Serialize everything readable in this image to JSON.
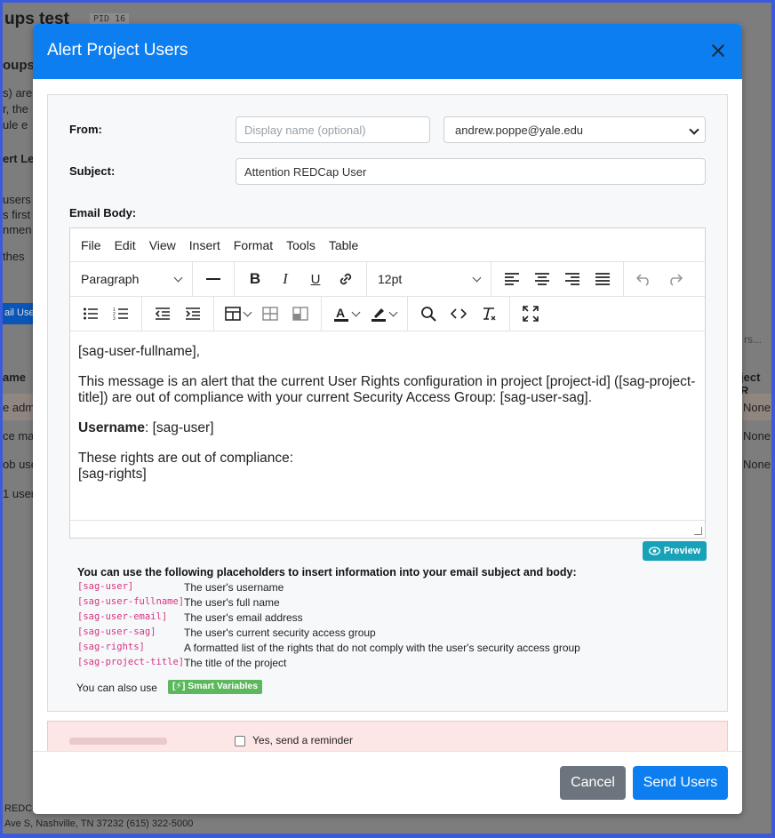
{
  "background": {
    "title": "ups test",
    "pid": "PID 16",
    "fragments": [
      "oups",
      "s) are",
      "r, the",
      "ule e",
      "ert Le",
      "users",
      "s first",
      "nmen",
      "thes",
      "ame",
      "e adm",
      "ce ma",
      "ob use",
      "1 user",
      "rs...",
      "ject R",
      "None",
      "None",
      "None",
      "ail Use"
    ],
    "footer": "Ave S, Nashville, TN 37232 (615) 322-5000",
    "footer_top": "REDC"
  },
  "modal": {
    "title": "Alert Project Users",
    "from_label": "From:",
    "display_name_placeholder": "Display name (optional)",
    "from_email": "andrew.poppe@yale.edu",
    "subject_label": "Subject:",
    "subject_value": "Attention REDCap User",
    "body_label": "Email Body:"
  },
  "editor": {
    "menus": [
      "File",
      "Edit",
      "View",
      "Insert",
      "Format",
      "Tools",
      "Table"
    ],
    "block_format": "Paragraph",
    "font_size": "12pt",
    "content": {
      "line1": "[sag-user-fullname],",
      "line2": "This message is an alert that the current User Rights configuration in project [project-id] ([sag-project-title]) are out of compliance with your current Security Access Group: [sag-user-sag].",
      "username_bold": "Username",
      "username_rest": ": [sag-user]",
      "line4a": "These rights are out of compliance:",
      "line4b": "[sag-rights]"
    }
  },
  "preview_label": "Preview",
  "placeholders": {
    "title": "You can use the following placeholders to insert information into your email subject and body:",
    "items": [
      {
        "code": "[sag-user]",
        "desc": "The user's username"
      },
      {
        "code": "[sag-user-fullname]",
        "desc": "The user's full name"
      },
      {
        "code": "[sag-user-email]",
        "desc": "The user's email address"
      },
      {
        "code": "[sag-user-sag]",
        "desc": "The user's current security access group"
      },
      {
        "code": "[sag-rights]",
        "desc": "A formatted list of the rights that do not comply with the user's security access group"
      },
      {
        "code": "[sag-project-title]",
        "desc": "The title of the project"
      }
    ],
    "also_text": "You can also use",
    "smart_vars": "[⚡] Smart Variables"
  },
  "reminder": {
    "checkbox_label": "Yes, send a reminder"
  },
  "footer": {
    "cancel": "Cancel",
    "send": "Send Users"
  },
  "colors": {
    "header": "#0d7ef0",
    "send_button": "#0d7ef0",
    "cancel_button": "#6c757d",
    "preview_button": "#17a2b8",
    "smart_variables": "#5cb85c",
    "placeholder_code": "#d63384"
  }
}
